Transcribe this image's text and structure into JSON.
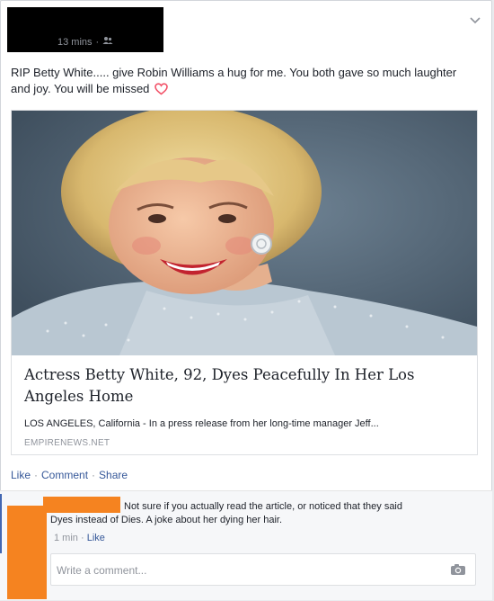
{
  "post": {
    "time": "13 mins",
    "separator": "·",
    "privacy_icon": "friends-icon",
    "text": "RIP Betty White..... give Robin Williams a hug for me. You both gave so much laughter and joy. You will be missed",
    "emoji": "heart-icon"
  },
  "link_card": {
    "title": "Actress Betty White, 92, Dyes Peacefully In Her Los Angeles Home",
    "description": "LOS ANGELES, California - In a press release from her long-time manager Jeff...",
    "domain": "EMPIRENEWS.NET"
  },
  "actions": {
    "like": "Like",
    "comment": "Comment",
    "share": "Share",
    "separator": "·"
  },
  "comment": {
    "text_line1": "Not sure if you actually read the article, or noticed that they said",
    "text_line2": "Dyes instead of Dies. A joke about her dying her hair.",
    "time": "1 min",
    "separator": "·",
    "like": "Like"
  },
  "composer": {
    "placeholder": "Write a comment...",
    "camera_icon": "camera-icon"
  },
  "colors": {
    "link": "#365899",
    "meta": "#90949c",
    "redact_black": "#000000",
    "redact_orange": "#f58320",
    "heart": "#f25268"
  }
}
